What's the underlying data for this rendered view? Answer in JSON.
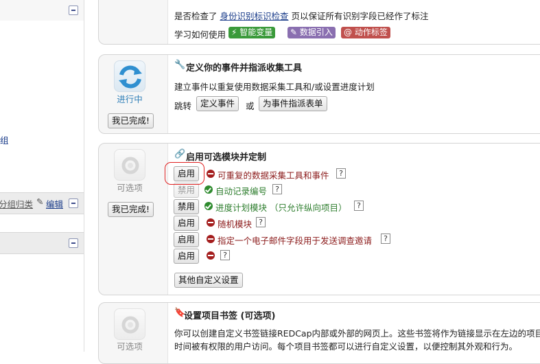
{
  "sidebar": {
    "partial_text_1": "组",
    "partial_link": "分组归类",
    "edit_label": "编辑"
  },
  "card_top": {
    "line1_prefix": "是否检查了",
    "line1_link": "身份识别标识检查",
    "line1_suffix": "页以保证所有识别字段已经作了标注",
    "learn_label": "学习如何使用",
    "badges": [
      {
        "label": "智能变量",
        "color": "#3a9a3a"
      },
      {
        "label": "数据引入",
        "color": "#8a6fb0"
      },
      {
        "label": "@ 动作标签",
        "color": "#c0504d"
      }
    ]
  },
  "card_events": {
    "status": "进行中",
    "done_button": "我已完成!",
    "title": "定义你的事件并指派收集工具",
    "description": "建立事件以重复使用数据采集工具和/或设置进度计划",
    "jump_label": "跳转",
    "define_events_button": "定义事件",
    "or_label": "或",
    "designate_button": "为事件指派表单"
  },
  "card_modules": {
    "status": "可选项",
    "done_button": "我已完成!",
    "title": "启用可选模块并定制",
    "modules": [
      {
        "button": "启用",
        "state": "off",
        "label": "可重复的数据采集工具和事件",
        "button_disabled": false
      },
      {
        "button": "禁用",
        "state": "on",
        "label": "自动记录编号",
        "button_disabled": true
      },
      {
        "button": "禁用",
        "state": "on",
        "label": "进度计划模块 （只允许纵向项目）",
        "button_disabled": false
      },
      {
        "button": "启用",
        "state": "off",
        "label": "随机模块",
        "button_disabled": false
      },
      {
        "button": "启用",
        "state": "off",
        "label": "指定一个电子邮件字段用于发送调查邀请",
        "button_disabled": false
      },
      {
        "button": "启用",
        "state": "off",
        "label": "",
        "button_disabled": false
      }
    ],
    "help_label": "?",
    "other_settings_button": "其他自定义设置"
  },
  "card_bookmarks": {
    "status": "可选项",
    "title": "设置项目书签 (可选项)",
    "line1": "你可以创建自定义书签链接REDCap内部或外部的网页上。这些书签将作为链接显示在左边的项目",
    "line2": "时间被有权限的用户访问。每个项目书签都可以进行自定义设置，以便控制其外观和行为。"
  },
  "colors": {
    "link": "#1a3c8a",
    "enabled_green": "#2d7d2d",
    "disabled_red": "#8b1a1a",
    "highlight": "#e02020"
  }
}
